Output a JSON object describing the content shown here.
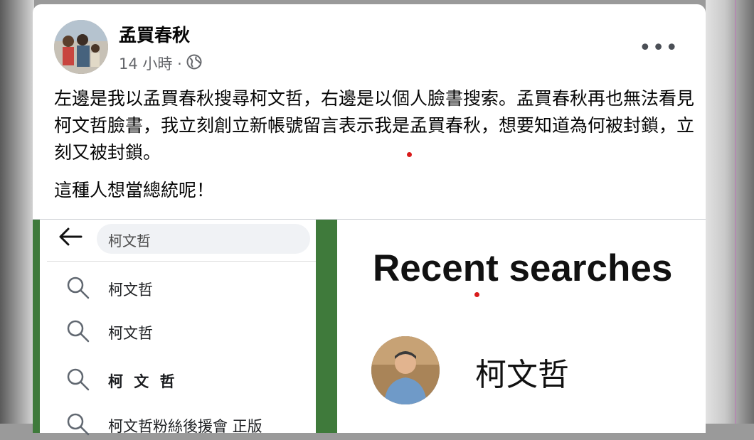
{
  "post": {
    "author": "孟買春秋",
    "time": "14 小時 ·",
    "paragraphs": [
      "左邊是我以孟買春秋搜尋柯文哲，右邊是以個人臉書搜索。孟買春秋再也無法看見柯文哲臉書，我立刻創立新帳號留言表示我是孟買春秋，想要知道為何被封鎖，立刻又被封鎖。",
      "這種人想當總統呢！"
    ],
    "more_label": "•••",
    "icons": {
      "privacy": "globe-icon",
      "more": "more-options-icon"
    }
  },
  "left_screenshot": {
    "search_value": "柯文哲",
    "suggestions": [
      {
        "label": "柯文哲"
      },
      {
        "label": "柯文哲"
      },
      {
        "label": "柯 文 哲"
      },
      {
        "label": "柯文哲粉絲後援會 正版"
      }
    ],
    "icons": {
      "back": "back-arrow-icon",
      "search": "search-icon"
    },
    "accent_color": "#3f7a3b"
  },
  "right_screenshot": {
    "title": "Recent searches",
    "result_name": "柯文哲"
  }
}
